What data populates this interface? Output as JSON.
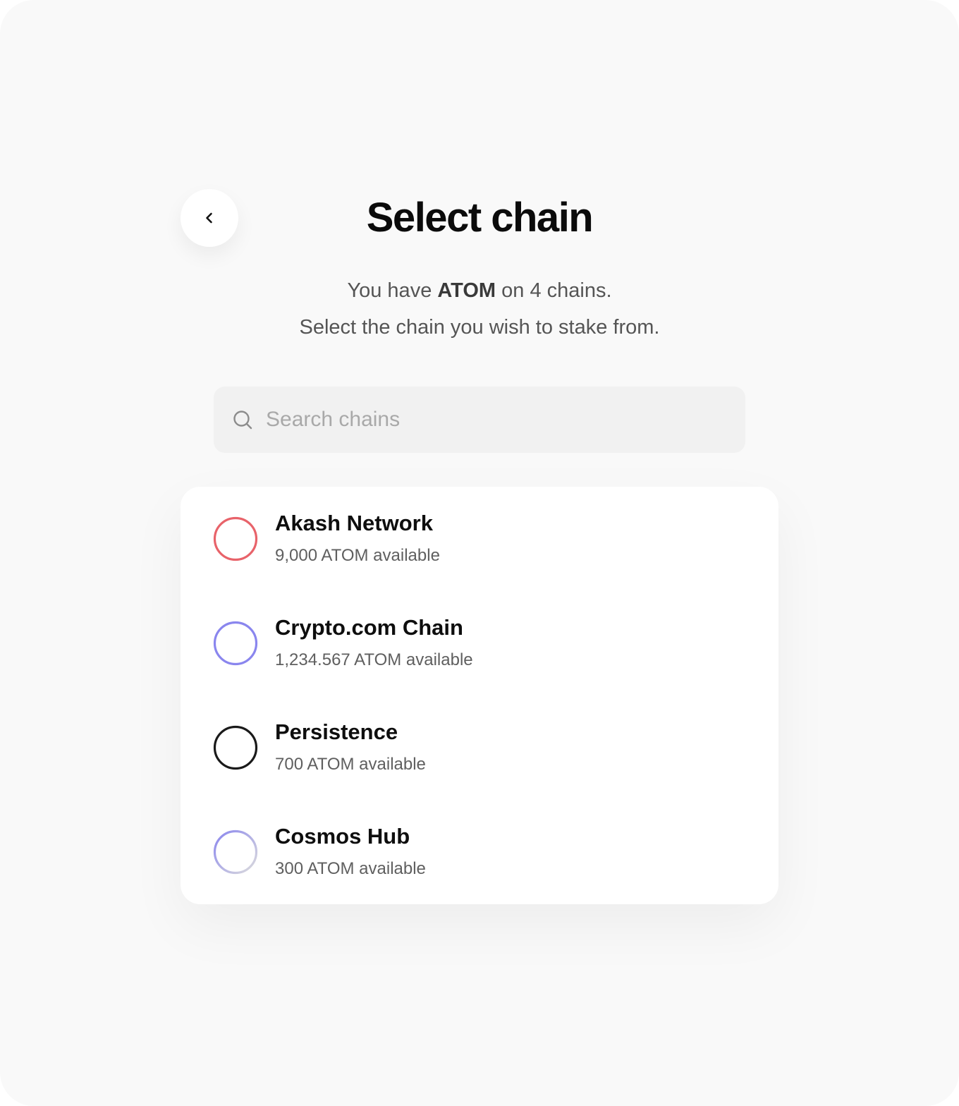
{
  "header": {
    "back_icon": "chevron-left-icon",
    "title": "Select chain"
  },
  "subtitle": {
    "line1_prefix": "You have",
    "token": "ATOM",
    "line1_suffix": "on 4 chains.",
    "line2": "Select the chain you wish to stake from."
  },
  "search": {
    "icon": "search-icon",
    "placeholder": "Search chains",
    "value": ""
  },
  "chains": [
    {
      "name": "Akash Network",
      "amount": "9,000 ATOM available",
      "ring_color": "#e8636a",
      "ring_color_end": "#e8636a"
    },
    {
      "name": "Crypto.com Chain",
      "amount": "1,234.567 ATOM available",
      "ring_color": "#8a86ee",
      "ring_color_end": "#8a86ee"
    },
    {
      "name": "Persistence",
      "amount": "700 ATOM available",
      "ring_color": "#1a1a1a",
      "ring_color_end": "#1a1a1a"
    },
    {
      "name": "Cosmos Hub",
      "amount": "300 ATOM available",
      "ring_color": "#8a86ee",
      "ring_color_end": "#dcdcdc"
    }
  ]
}
